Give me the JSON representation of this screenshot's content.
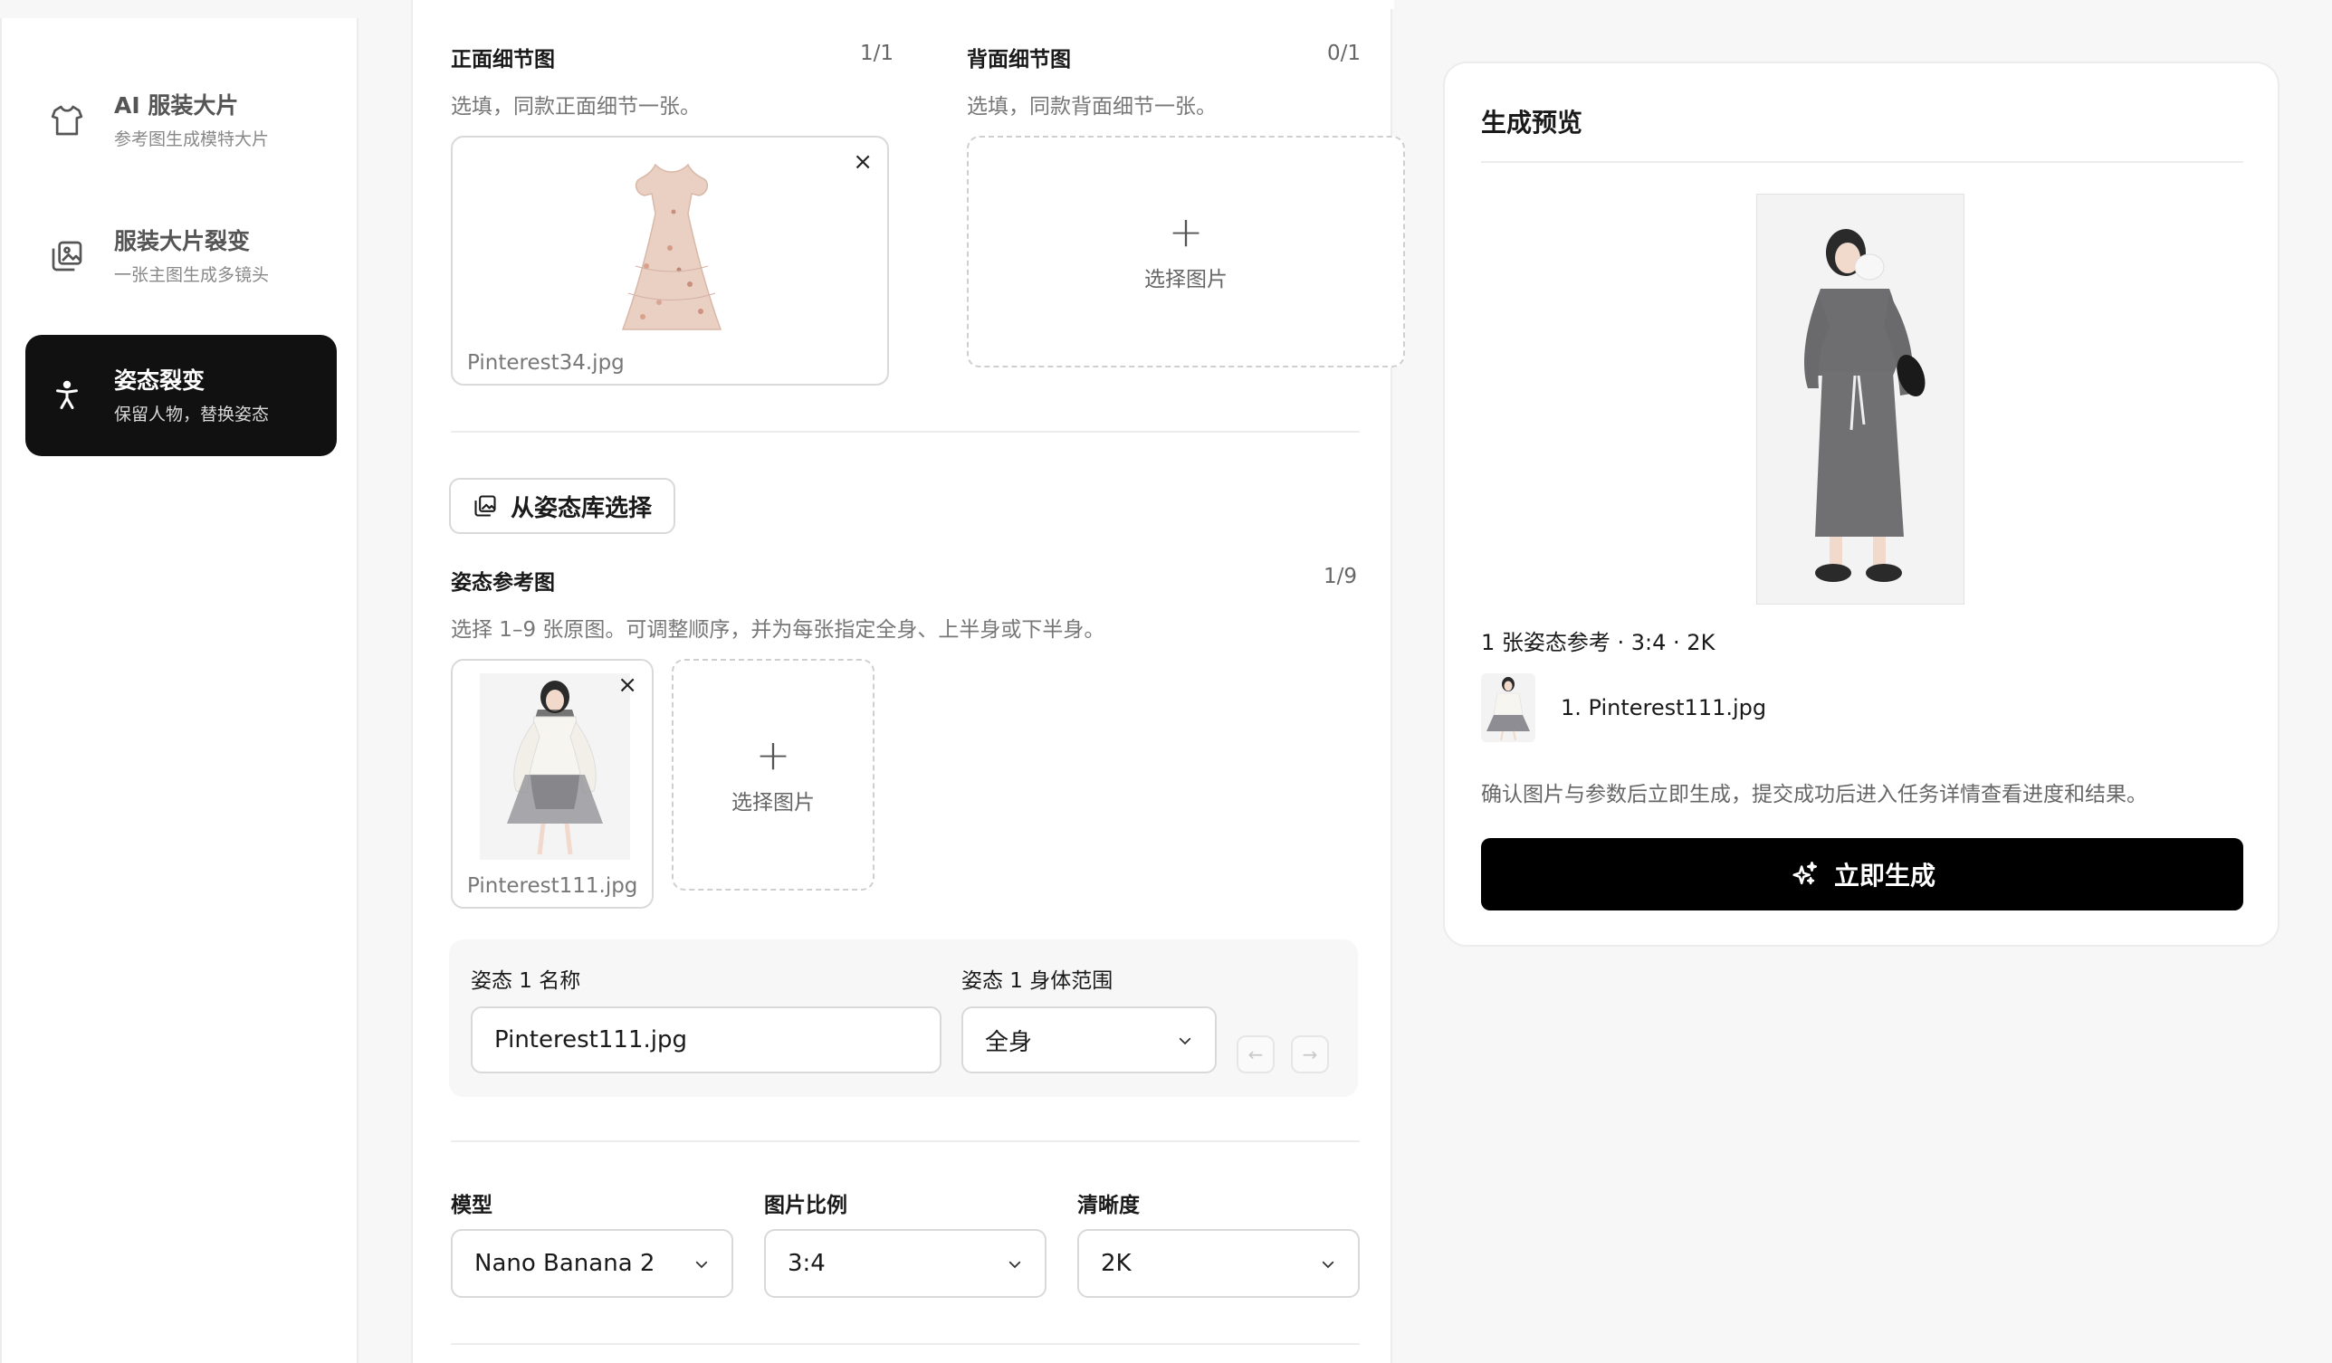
{
  "sidebar": {
    "items": [
      {
        "title": "AI 服装大片",
        "subtitle": "参考图生成模特大片",
        "icon": "tshirt-icon",
        "active": false
      },
      {
        "title": "服装大片裂变",
        "subtitle": "一张主图生成多镜头",
        "icon": "image-stack-icon",
        "active": false
      },
      {
        "title": "姿态裂变",
        "subtitle": "保留人物，替换姿态",
        "icon": "figure-icon",
        "active": true
      }
    ]
  },
  "detail": {
    "front": {
      "label": "正面细节图",
      "count": "1/1",
      "hint": "选填，同款正面细节一张。",
      "filename": "Pinterest34.jpg"
    },
    "back": {
      "label": "背面细节图",
      "count": "0/1",
      "hint": "选填，同款背面细节一张。",
      "select_label": "选择图片"
    }
  },
  "pose_library_button": "从姿态库选择",
  "pose_ref": {
    "label": "姿态参考图",
    "count": "1/9",
    "hint": "选择 1–9 张原图。可调整顺序，并为每张指定全身、上半身或下半身。",
    "filename": "Pinterest111.jpg",
    "select_label": "选择图片"
  },
  "pose_item": {
    "name_label": "姿态 1 名称",
    "name_value": "Pinterest111.jpg",
    "range_label": "姿态 1 身体范围",
    "range_value": "全身",
    "prev_arrow": "←",
    "next_arrow": "→"
  },
  "settings": {
    "model": {
      "label": "模型",
      "value": "Nano Banana 2"
    },
    "ratio": {
      "label": "图片比例",
      "value": "3:4"
    },
    "quality": {
      "label": "清晰度",
      "value": "2K"
    }
  },
  "preview": {
    "title": "生成预览",
    "meta": "1 张姿态参考 · 3:4 · 2K",
    "item": "1. Pinterest111.jpg",
    "desc": "确认图片与参数后立即生成，提交成功后进入任务详情查看进度和结果。",
    "generate_label": "立即生成"
  },
  "colors": {
    "accent": "#111111",
    "border": "#d9d9d9",
    "muted": "#777777"
  }
}
